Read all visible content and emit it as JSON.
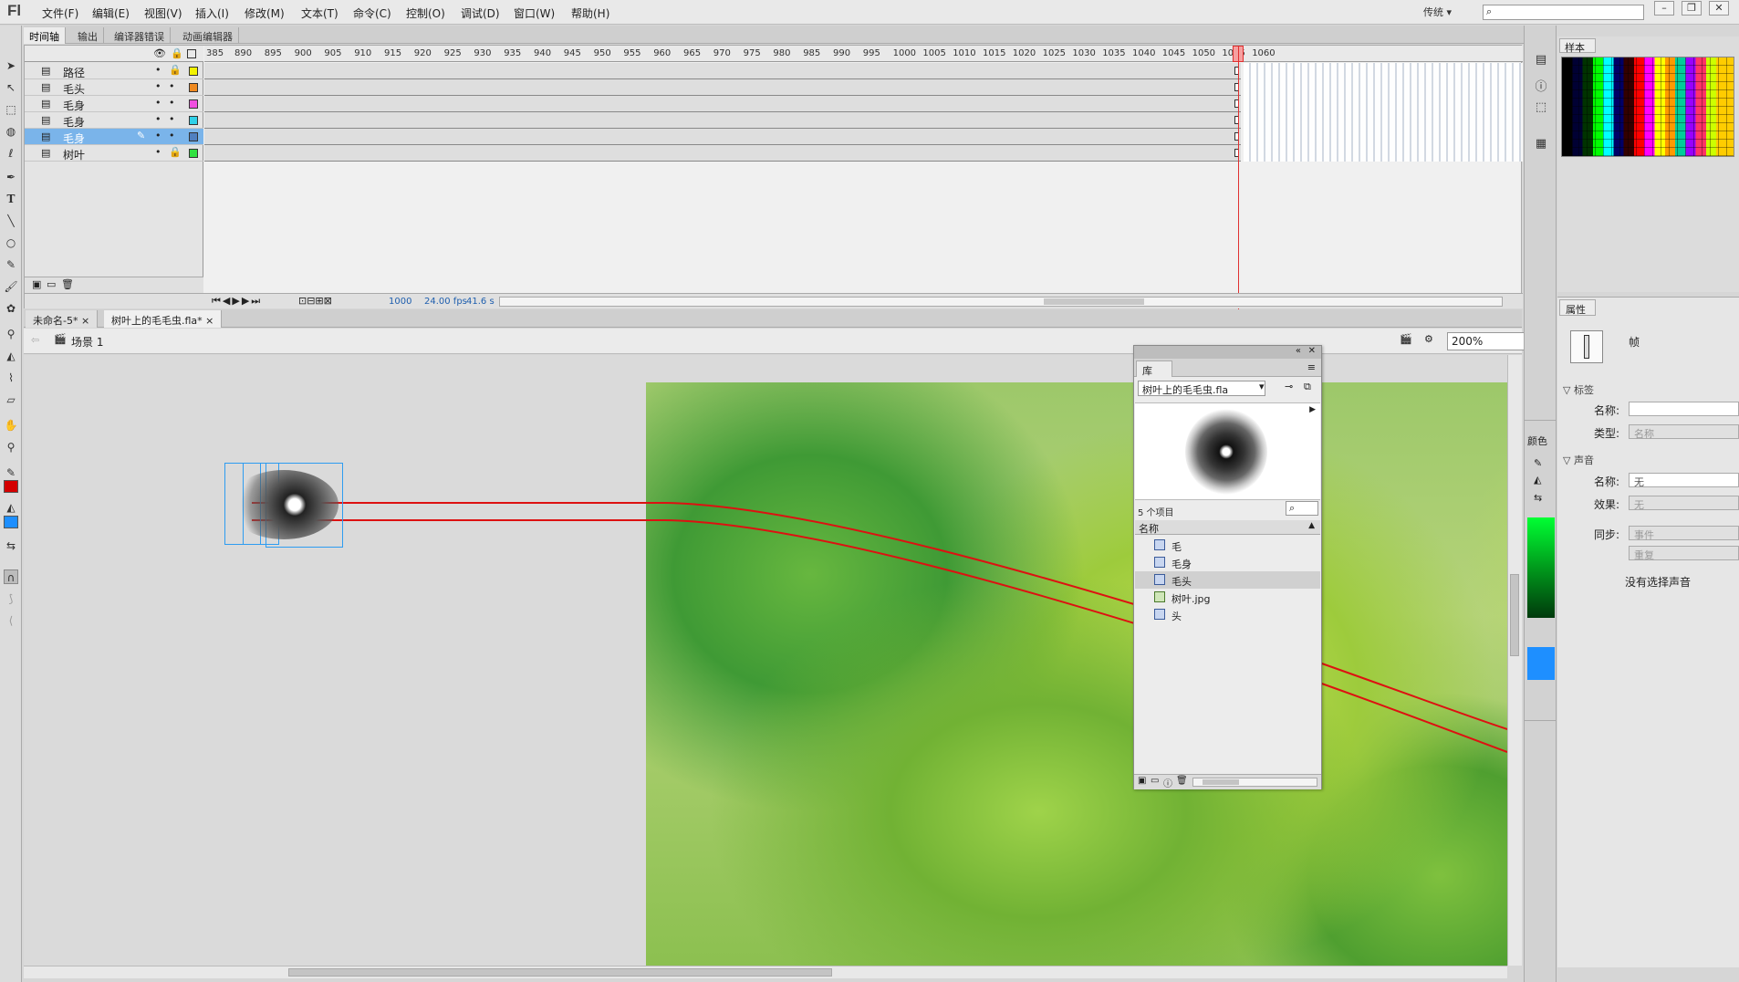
{
  "app": {
    "logo": "Fl",
    "workspace": "传统 ▾"
  },
  "menu": [
    "文件(F)",
    "编辑(E)",
    "视图(V)",
    "插入(I)",
    "修改(M)",
    "文本(T)",
    "命令(C)",
    "控制(O)",
    "调试(D)",
    "窗口(W)",
    "帮助(H)"
  ],
  "panel_tabs": [
    "时间轴",
    "输出",
    "编译器错误",
    "动画编辑器"
  ],
  "timeline": {
    "ruler": [
      "385",
      "890",
      "895",
      "900",
      "905",
      "910",
      "915",
      "920",
      "925",
      "930",
      "935",
      "940",
      "945",
      "950",
      "955",
      "960",
      "965",
      "970",
      "975",
      "980",
      "985",
      "990",
      "995",
      "1000",
      "1005",
      "1010",
      "1015",
      "1020",
      "1025",
      "1030",
      "1035",
      "1040",
      "1045",
      "1050",
      "1055",
      "1060"
    ],
    "layers": [
      {
        "name": "路径",
        "color": "#f2f200",
        "selected": false,
        "locked": true
      },
      {
        "name": "毛头",
        "color": "#f08a20",
        "selected": false,
        "locked": false
      },
      {
        "name": "毛身",
        "color": "#f050e0",
        "selected": false,
        "locked": false
      },
      {
        "name": "毛身",
        "color": "#30d0e8",
        "selected": false,
        "locked": false
      },
      {
        "name": "毛身",
        "color": "#5080c0",
        "selected": true,
        "locked": false
      },
      {
        "name": "树叶",
        "color": "#30e040",
        "selected": false,
        "locked": true
      }
    ],
    "status": {
      "frame": "1000",
      "fps": "24.00 fps",
      "time": "41.6 s"
    }
  },
  "doc_tabs": [
    "未命名-5*",
    "树叶上的毛毛虫.fla*"
  ],
  "scene": {
    "label": "场景 1",
    "zoom": "200%"
  },
  "library": {
    "tab": "库",
    "document": "树叶上的毛毛虫.fla",
    "count": "5 个项目",
    "header": "名称",
    "items": [
      {
        "label": "毛",
        "type": "symbol",
        "selected": false
      },
      {
        "label": "毛身",
        "type": "symbol",
        "selected": false
      },
      {
        "label": "毛头",
        "type": "symbol",
        "selected": true
      },
      {
        "label": "树叶.jpg",
        "type": "bitmap",
        "selected": false
      },
      {
        "label": "头",
        "type": "symbol",
        "selected": false
      }
    ]
  },
  "swatches": {
    "tab": "样本"
  },
  "color_panel": {
    "tab": "颜色"
  },
  "properties": {
    "tab": "属性",
    "kind": "帧",
    "section_label": "标签",
    "name_label": "名称:",
    "name_value": "",
    "type_label": "类型:",
    "type_value": "名称",
    "section_sound": "声音",
    "sound_name_label": "名称:",
    "sound_name_value": "无",
    "effect_label": "效果:",
    "effect_value": "无",
    "sync_label": "同步:",
    "sync_value": "事件",
    "repeat_value": "重复",
    "no_sound": "没有选择声音"
  },
  "colors": {
    "stroke": "#d40000",
    "fill": "#1e8fff",
    "path": "#dd1111"
  }
}
